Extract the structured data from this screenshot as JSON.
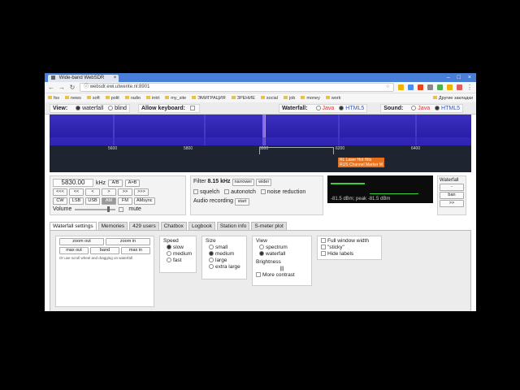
{
  "browser": {
    "tab_title": "Wide-band WebSDR",
    "url": "websdr.ewi.utwente.nl:8901",
    "bookmarks": [
      "fss",
      "news",
      "soft",
      "polit",
      "radio",
      "intrt",
      "my_site",
      "ЭМИГРАЦИЯ",
      "ЗРЕНИЕ",
      "social",
      "job",
      "money",
      "work"
    ],
    "other_bookmarks": "Другие закладки",
    "ext_colors": [
      "#f0b400",
      "#4a8cf0",
      "#e8441c",
      "#888888",
      "#4caf50",
      "#f0b400",
      "#e06060"
    ]
  },
  "topbar": {
    "view_label": "View:",
    "view_options": [
      "waterfall",
      "blind"
    ],
    "keyboard_label": "Allow keyboard:",
    "waterfall_label": "Waterfall:",
    "waterfall_options": [
      "Java",
      "HTML5"
    ],
    "sound_label": "Sound:",
    "sound_options": [
      "Java",
      "HTML5"
    ]
  },
  "scale": {
    "labels": [
      "5600",
      "5800",
      "6000",
      "6200",
      "6400"
    ],
    "marker_lines": [
      "RL Laser Hot Hits",
      "RUS Channel Marker M"
    ]
  },
  "tuning": {
    "frequency": "5830.00",
    "unit": "kHz",
    "ab": [
      "A/B",
      "A=B"
    ],
    "steps": [
      "<<<",
      "<<",
      "<",
      ">",
      ">>",
      ">>>"
    ],
    "modes": [
      "CW",
      "LSB",
      "USB",
      "AM",
      "FM",
      "AMsync"
    ],
    "active_mode": "AM",
    "volume_label": "Volume",
    "mute_label": "mute"
  },
  "filter": {
    "label": "Filter",
    "value": "8.15 kHz",
    "buttons": [
      "narrower",
      "wider"
    ],
    "options": [
      "squelch",
      "autonotch",
      "noise reduction"
    ],
    "recording_label": "Audio recording",
    "start_label": "start"
  },
  "smeter": {
    "readout": "-81.5 dBm; peak -81.5 dBm",
    "level": 0.35
  },
  "wf_side": {
    "label": "Waterfall",
    "buttons": [
      "-",
      "ban",
      ">>"
    ]
  },
  "tabs": [
    "Waterfall settings",
    "Memories",
    "429 users",
    "Chatbox",
    "Logbook",
    "Station info",
    "S-meter plot"
  ],
  "zoom": {
    "buttons": [
      "zoom out",
      "zoom in",
      "max out",
      "band",
      "max in"
    ],
    "hint": "Or use scroll wheel and dragging on waterfall"
  },
  "speed": {
    "title": "Speed",
    "options": [
      "slow",
      "medium",
      "fast"
    ],
    "selected": "slow"
  },
  "size": {
    "title": "Size",
    "options": [
      "small",
      "medium",
      "large",
      "extra large"
    ],
    "selected": "medium"
  },
  "view": {
    "title": "View",
    "options": [
      "spectrum",
      "waterfall"
    ],
    "selected": "waterfall",
    "brightness_label": "Brightness",
    "more_contrast": "More contrast"
  },
  "extras": {
    "options": [
      "Full window width",
      "\"sticky\"",
      "Hide labels"
    ]
  }
}
